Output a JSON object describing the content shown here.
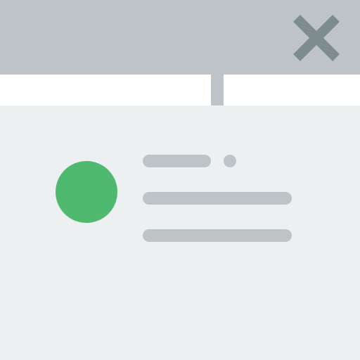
{
  "colors": {
    "titlebar": "#bdc3c7",
    "close_icon": "#7f8c8d",
    "gap": "#ffffff",
    "connector": "#bdc3c7",
    "panel": "#ecf0f1",
    "avatar": "#4fba6f",
    "placeholder_line": "#bdc3c7"
  },
  "titlebar": {
    "close_icon": "close-icon"
  },
  "notification": {
    "avatar_icon": "avatar",
    "lines": [
      "title-placeholder",
      "body-placeholder",
      "body-placeholder"
    ]
  }
}
